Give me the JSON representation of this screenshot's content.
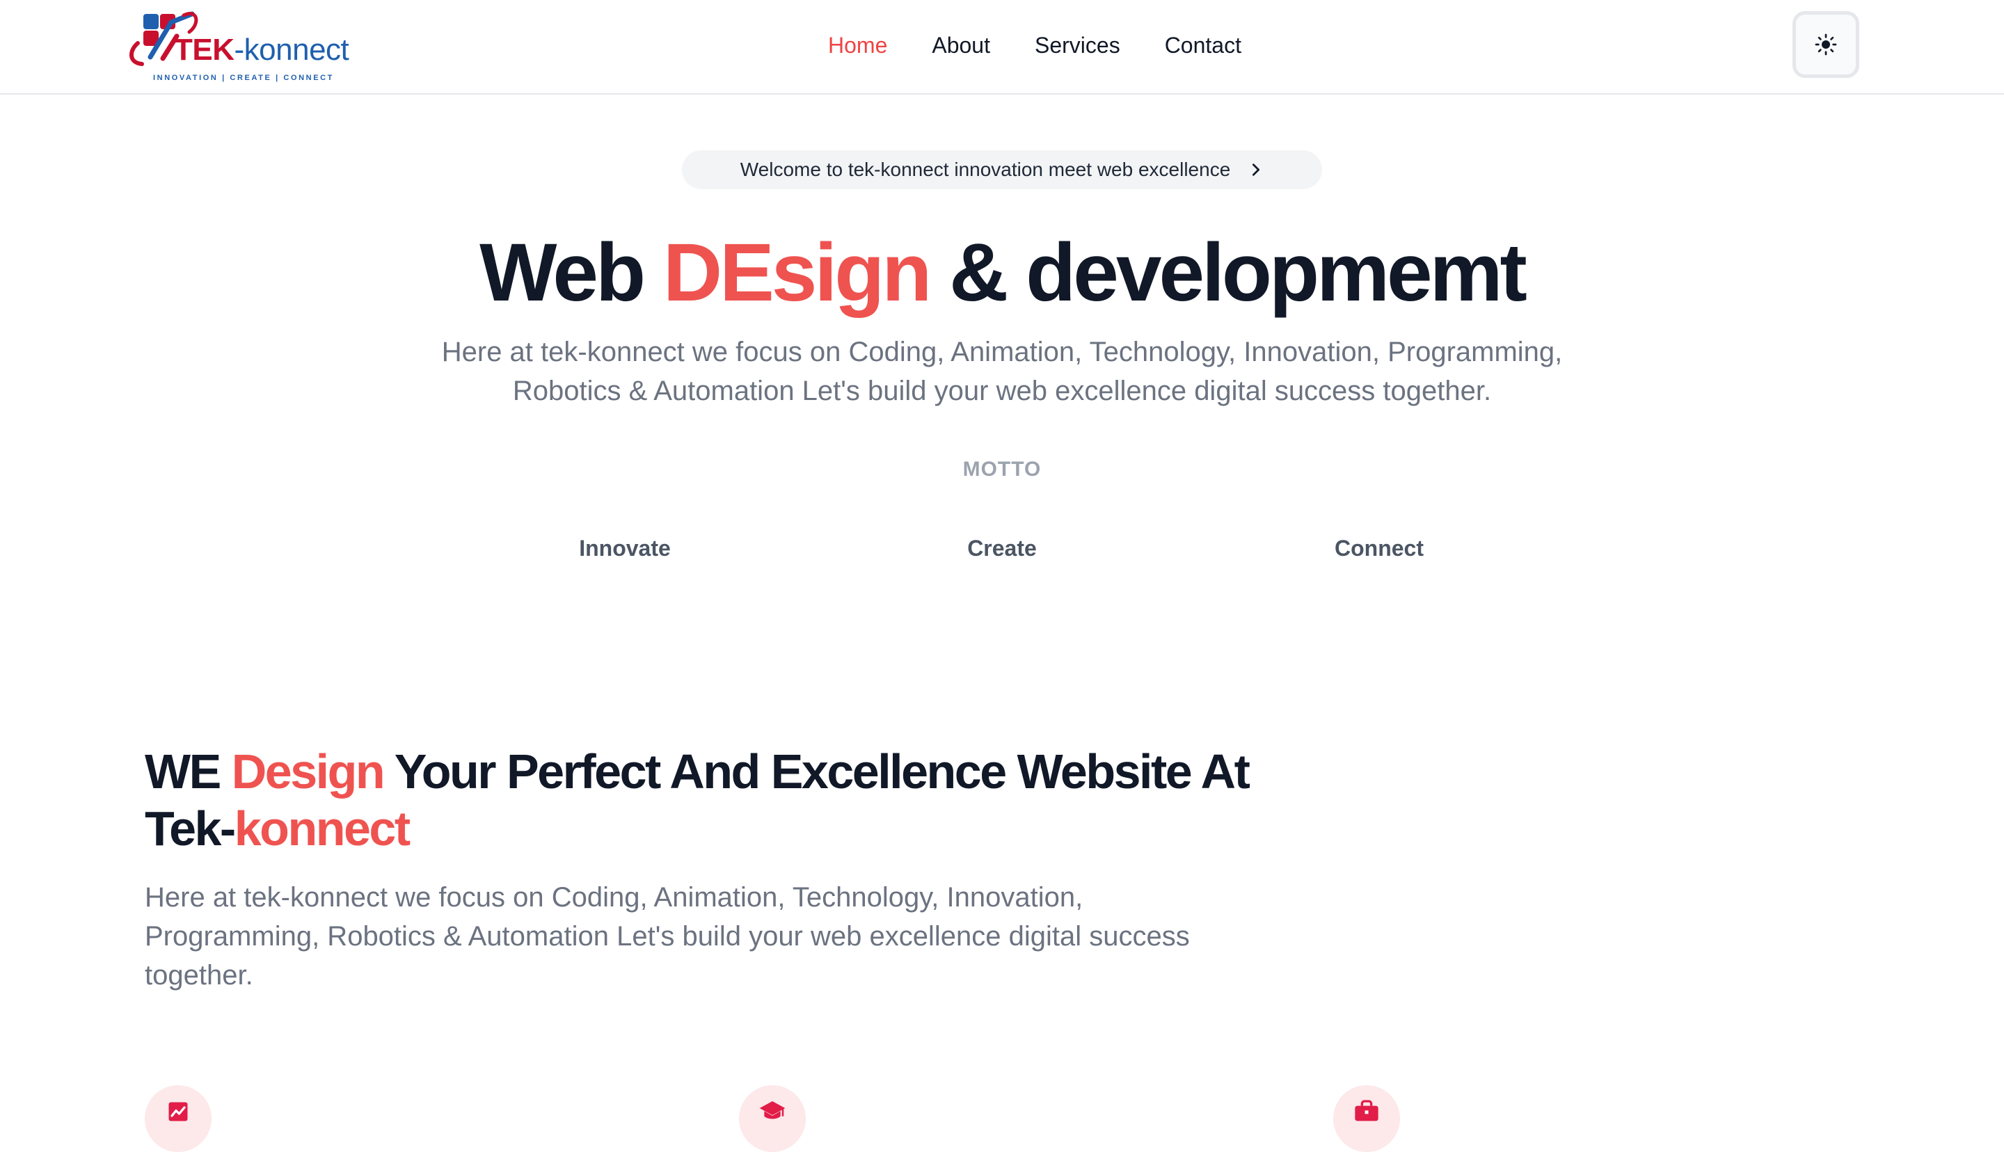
{
  "brand": {
    "name_part1": "TEK",
    "name_part2": "-konnect",
    "tagline": "INNOVATION | CREATE | CONNECT",
    "primary_color": "#c8102e",
    "secondary_color": "#1f5fae"
  },
  "nav": {
    "items": [
      {
        "label": "Home",
        "active": true
      },
      {
        "label": "About",
        "active": false
      },
      {
        "label": "Services",
        "active": false
      },
      {
        "label": "Contact",
        "active": false
      }
    ]
  },
  "theme_toggle": {
    "icon": "sun-icon"
  },
  "hero": {
    "announcement": "Welcome to tek-konnect innovation meet web excellence",
    "title_part1": "Web ",
    "title_accent": "DEsign",
    "title_part2": " & developmemt",
    "description": "Here at tek-konnect we focus on Coding, Animation, Technology, Innovation, Programming, Robotics & Automation Let's build your web excellence digital success together.",
    "accent_color": "#ef5350"
  },
  "motto": {
    "label": "MOTTO",
    "items": [
      "Innovate",
      "Create",
      "Connect"
    ]
  },
  "section": {
    "title_part1": "WE ",
    "title_accent1": "Design",
    "title_part2": " Your Perfect And Excellence Website At Tek-",
    "title_accent2": "konnect",
    "description": "Here at tek-konnect we focus on Coding, Animation, Technology, Innovation, Programming, Robotics & Automation Let's build your web excellence digital success together.",
    "features": [
      {
        "icon": "chart-icon"
      },
      {
        "icon": "graduation-cap-icon"
      },
      {
        "icon": "briefcase-icon"
      }
    ]
  }
}
